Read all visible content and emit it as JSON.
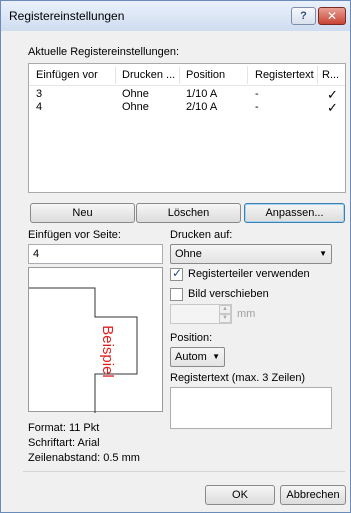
{
  "window": {
    "title": "Registereinstellungen",
    "help_label": "?",
    "close_label": "✕"
  },
  "current": {
    "label": "Aktuelle Registereinstellungen:",
    "columns": [
      "Einfügen vor",
      "Drucken ...",
      "Position",
      "Registertext",
      "R..."
    ],
    "rows": [
      {
        "einfuegen": "3",
        "drucken": "Ohne",
        "position": "1/10 A",
        "text": "-",
        "r": "✓"
      },
      {
        "einfuegen": "4",
        "drucken": "Ohne",
        "position": "2/10 A",
        "text": "-",
        "r": "✓"
      }
    ]
  },
  "buttons": {
    "new": "Neu",
    "delete": "Löschen",
    "customize": "Anpassen...",
    "ok": "OK",
    "cancel": "Abbrechen"
  },
  "insert_before": {
    "label": "Einfügen vor Seite:",
    "value": "4"
  },
  "print_on": {
    "label": "Drucken auf:",
    "value": "Ohne"
  },
  "options": {
    "divider_label": "Registerteiler verwenden",
    "divider_checked": true,
    "move_image_label": "Bild verschieben",
    "move_image_checked": false,
    "mm_unit": "mm"
  },
  "position": {
    "label": "Position:",
    "value": "Autom"
  },
  "register_text": {
    "label": "Registertext (max. 3 Zeilen)",
    "value": ""
  },
  "preview": {
    "sample": "Beispiel"
  },
  "info": {
    "format": "Format: 11 Pkt",
    "font": "Schriftart: Arial",
    "spacing": "Zeilenabstand: 0.5 mm"
  },
  "colors": {
    "sample_text": "#e02020",
    "focus_border": "#3c7fb1",
    "close_button": "#c84535"
  }
}
